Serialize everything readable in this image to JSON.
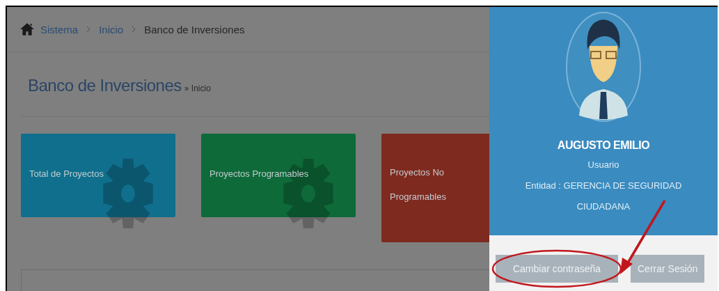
{
  "breadcrumb": [
    {
      "label": "Sistema",
      "link": true
    },
    {
      "label": "Inicio",
      "link": true
    },
    {
      "label": "Banco de Inversiones",
      "link": false
    }
  ],
  "page_header": {
    "title": "Banco de Inversiones",
    "subtitle": "» Inicio"
  },
  "cards": [
    {
      "title": "Total de Proyectos",
      "color": "#0f6f8c"
    },
    {
      "title": "Proyectos Programables",
      "color": "#0e6a39"
    },
    {
      "title": "Proyectos No Programables",
      "color": "#7f2a1f"
    }
  ],
  "user_panel": {
    "name": "AUGUSTO EMILIO",
    "role": "Usuario",
    "entity": "Entidad : GERENCIA DE SEGURIDAD CIUDADANA",
    "buttons": [
      {
        "label": "Cambiar contraseña",
        "highlighted": true
      },
      {
        "label": "Cerrar Sesión",
        "highlighted": false
      }
    ]
  }
}
